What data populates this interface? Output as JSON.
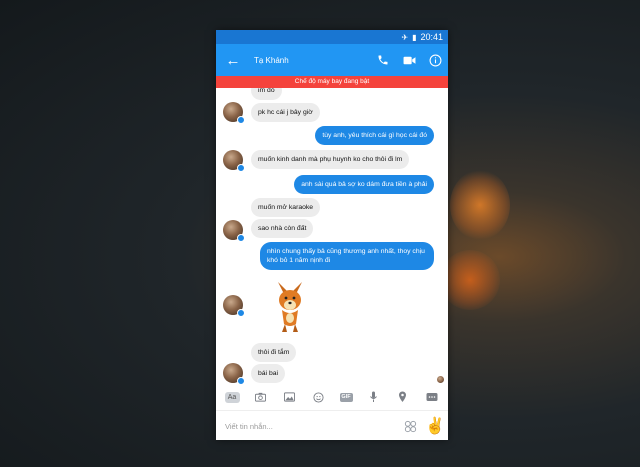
{
  "status_bar": {
    "time": "20:41",
    "icons": [
      "airplane-icon",
      "battery-icon"
    ]
  },
  "header": {
    "contact_name": "Tạ Khánh",
    "icons": [
      "back-arrow-icon",
      "phone-icon",
      "video-icon",
      "info-icon"
    ]
  },
  "banner": {
    "text": "Chế độ máy bay đang bật"
  },
  "messages": [
    {
      "side": "in",
      "text": "im đó"
    },
    {
      "side": "in",
      "text": "pk hc cái j bây giờ"
    },
    {
      "side": "out",
      "text": "tùy anh, yêu thích cái gì học cái đó"
    },
    {
      "side": "in",
      "text": "muốn kinh danh mà phụ huynh ko cho thôi đi lm"
    },
    {
      "side": "out",
      "text": "anh sài quá bả sợ ko dám đưa tiền à phải"
    },
    {
      "side": "in",
      "text": "muốn mở karaoke"
    },
    {
      "side": "in",
      "text": "sao nhà còn đất"
    },
    {
      "side": "out",
      "text": "nhìn chung thấy bả cũng thương anh nhất, thoy chịu khó bỏ 1 năm nịnh đi"
    },
    {
      "side": "in",
      "type": "sticker",
      "sticker": "fox-sticker"
    },
    {
      "side": "in",
      "text": "thôi đi tắm"
    },
    {
      "side": "in",
      "text": "bái bai"
    }
  ],
  "toolbar": {
    "aa_label": "Aa",
    "gif_label": "GIF",
    "icons": [
      "text-format-icon",
      "camera-icon",
      "image-icon",
      "emoji-icon",
      "gif-icon",
      "microphone-icon",
      "location-icon",
      "more-icon"
    ]
  },
  "composer": {
    "placeholder": "Viết tin nhắn...",
    "icons": [
      "emoji-picker-icon",
      "like-hand-icon"
    ]
  },
  "colors": {
    "accent": "#2196f3",
    "status_bar": "#1976d2",
    "banner": "#f4433c",
    "outgoing_bubble": "#1e88e5",
    "incoming_bubble": "#ececec"
  }
}
